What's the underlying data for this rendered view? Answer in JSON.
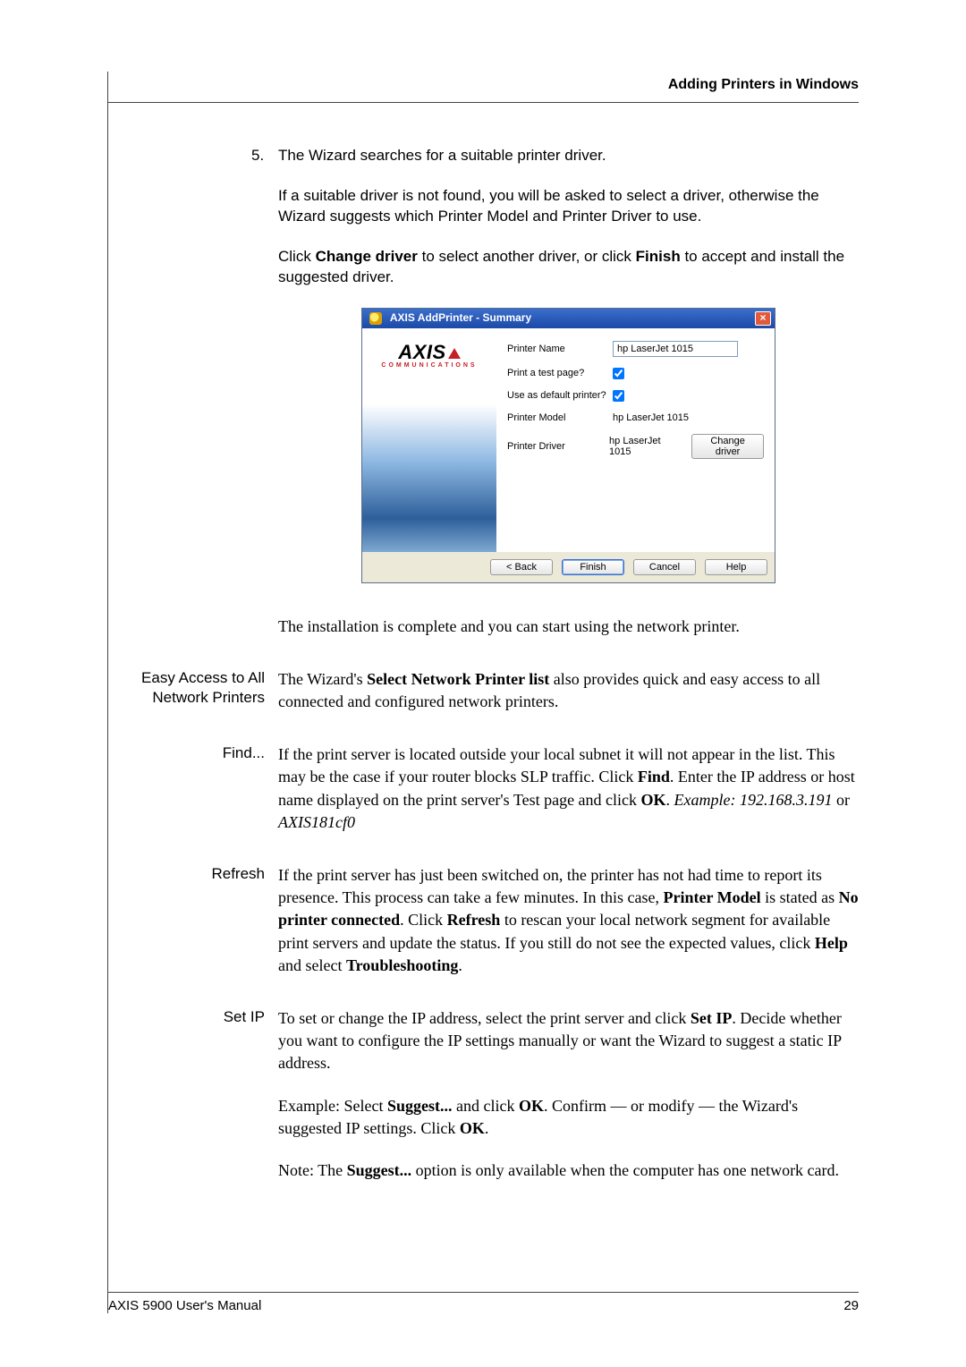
{
  "header": {
    "title": "Adding Printers in Windows"
  },
  "step5": {
    "num": "5.",
    "line1": "The Wizard searches for a suitable printer driver.",
    "line2": "If a suitable driver is not found, you will be asked to select a driver, otherwise the Wizard suggests which Printer Model and Printer Driver to use.",
    "line3_pre": "Click ",
    "change_driver": "Change driver",
    "line3_mid": " to select another driver, or click ",
    "finish": "Finish",
    "line3_post": " to accept and install the suggested driver."
  },
  "dialog": {
    "title": "AXIS AddPrinter - Summary",
    "close_x": "×",
    "brand": "AXIS",
    "brand_sub": "COMMUNICATIONS",
    "labels": {
      "printer_name": "Printer Name",
      "test_page": "Print a test page?",
      "default": "Use as default printer?",
      "model": "Printer Model",
      "driver": "Printer Driver"
    },
    "values": {
      "printer_name": "hp LaserJet 1015",
      "test_page_checked": true,
      "default_checked": true,
      "model": "hp LaserJet 1015",
      "driver": "hp LaserJet 1015"
    },
    "buttons": {
      "change": "Change driver",
      "back": "< Back",
      "finish": "Finish",
      "cancel": "Cancel",
      "help": "Help"
    }
  },
  "complete": "The installation is complete and you can start using the network printer.",
  "easy": {
    "label": "Easy Access to All Network Printers",
    "text_pre": "The Wizard's ",
    "bold": "Select Network Printer list",
    "text_post": " also provides quick and easy access to all connected and configured network printers."
  },
  "find": {
    "label": "Find...",
    "p1": "If the print server is located outside your local subnet it will not appear in the list. This may be the case if your router blocks SLP traffic. Click ",
    "b1": "Find",
    "p2": ". Enter the IP address or host name displayed on the print server's Test page and click ",
    "b2": "OK",
    "p3": ". ",
    "ex_label": "Example: 192.168.3.191",
    "p4": " or ",
    "ex2": "AXIS181cf0"
  },
  "refresh": {
    "label": "Refresh",
    "p1": "If the print server has just been switched on, the printer has not had time to report its presence. This process can take a few minutes. In this case, ",
    "b1": "Printer Model",
    "p2": " is stated as ",
    "b2": "No printer connected",
    "p3": ". Click ",
    "b3": "Refresh",
    "p4": " to rescan your local network segment for available print servers and update the status. If you still do not see the expected values, click ",
    "b4": "Help",
    "p5": " and select ",
    "b5": "Troubleshooting",
    "p6": "."
  },
  "setip": {
    "label": "Set IP",
    "p1": "To set or change the IP address, select the print server and click ",
    "b1": "Set IP",
    "p2": ". Decide whether you want to configure the IP settings manually or want the Wizard to suggest a static IP address.",
    "ex_pre": "Example: Select ",
    "ex_b1": "Suggest...",
    "ex_mid1": " and click ",
    "ex_b2": "OK",
    "ex_mid2": ". Confirm — or modify — the Wizard's suggested IP settings. Click ",
    "ex_b3": "OK",
    "ex_post": ".",
    "note_pre": "Note: The ",
    "note_b": "Suggest...",
    "note_post": " option is only available when the computer has one network card."
  },
  "footer": {
    "left": "AXIS 5900 User's Manual",
    "right": "29"
  }
}
